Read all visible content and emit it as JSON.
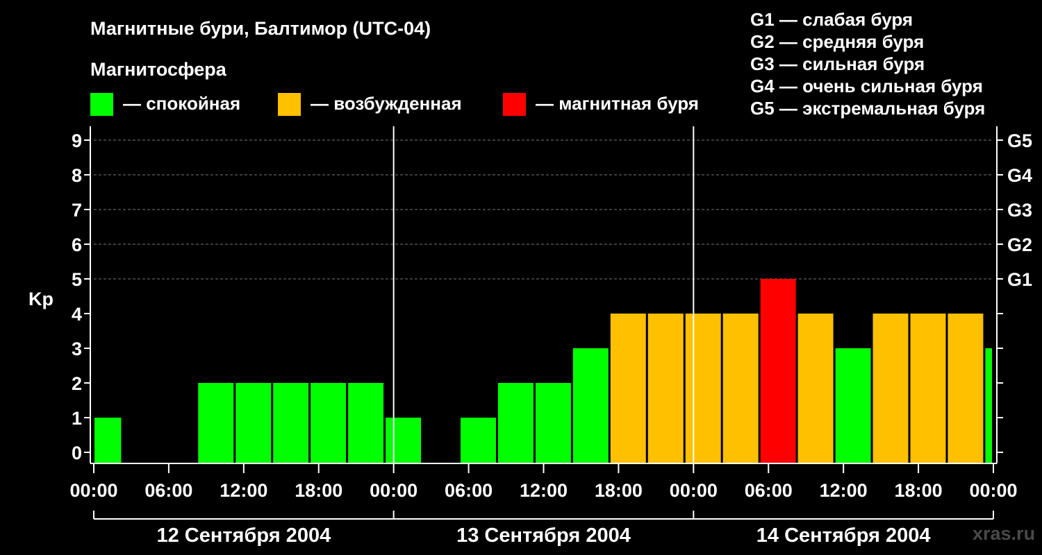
{
  "header": {
    "title": "Магнитные бури, Балтимор (UTC-04)",
    "subtitle": "Магнитосфера"
  },
  "legend_states": [
    {
      "label": "— спокойная",
      "color": "#00ff00"
    },
    {
      "label": "— возбужденная",
      "color": "#ffc000"
    },
    {
      "label": "— магнитная буря",
      "color": "#ff0000"
    }
  ],
  "legend_storms": [
    "G1 — слабая буря",
    "G2 — средняя буря",
    "G3 — сильная буря",
    "G4 — очень сильная буря",
    "G5 — экстремальная буря"
  ],
  "watermark": "xras.ru",
  "chart_data": {
    "type": "bar",
    "title": "Магнитные бури, Балтимор (UTC-04)",
    "ylabel": "Kp",
    "ylim": [
      0,
      9
    ],
    "yticks": [
      "0",
      "1",
      "2",
      "3",
      "4",
      "5",
      "6",
      "7",
      "8",
      "9"
    ],
    "right_axis": [
      {
        "kp": 5,
        "label": "G1"
      },
      {
        "kp": 6,
        "label": "G2"
      },
      {
        "kp": 7,
        "label": "G3"
      },
      {
        "kp": 8,
        "label": "G4"
      },
      {
        "kp": 9,
        "label": "G5"
      }
    ],
    "x_ticks": [
      "00:00",
      "06:00",
      "12:00",
      "18:00",
      "00:00",
      "06:00",
      "12:00",
      "18:00",
      "00:00",
      "06:00",
      "12:00",
      "18:00",
      "00:00"
    ],
    "days": [
      "12 Сентября 2004",
      "13 Сентября 2004",
      "14 Сентября 2004"
    ],
    "hours_span": 72,
    "bars": [
      {
        "start": 0,
        "end": 2.3,
        "kp": 1,
        "state": "quiet"
      },
      {
        "start": 2.3,
        "end": 5.3,
        "kp": 0,
        "state": "quiet"
      },
      {
        "start": 5.3,
        "end": 8.3,
        "kp": 0,
        "state": "quiet"
      },
      {
        "start": 8.3,
        "end": 11.3,
        "kp": 2,
        "state": "quiet"
      },
      {
        "start": 11.3,
        "end": 14.3,
        "kp": 2,
        "state": "quiet"
      },
      {
        "start": 14.3,
        "end": 17.3,
        "kp": 2,
        "state": "quiet"
      },
      {
        "start": 17.3,
        "end": 20.3,
        "kp": 2,
        "state": "quiet"
      },
      {
        "start": 20.3,
        "end": 23.3,
        "kp": 2,
        "state": "quiet"
      },
      {
        "start": 23.3,
        "end": 26.3,
        "kp": 1,
        "state": "quiet"
      },
      {
        "start": 26.3,
        "end": 29.3,
        "kp": 0,
        "state": "quiet"
      },
      {
        "start": 29.3,
        "end": 32.3,
        "kp": 1,
        "state": "quiet"
      },
      {
        "start": 32.3,
        "end": 35.3,
        "kp": 2,
        "state": "quiet"
      },
      {
        "start": 35.3,
        "end": 38.3,
        "kp": 2,
        "state": "quiet"
      },
      {
        "start": 38.3,
        "end": 41.3,
        "kp": 3,
        "state": "quiet"
      },
      {
        "start": 41.3,
        "end": 44.3,
        "kp": 4,
        "state": "active"
      },
      {
        "start": 44.3,
        "end": 47.3,
        "kp": 4,
        "state": "active"
      },
      {
        "start": 47.3,
        "end": 50.3,
        "kp": 4,
        "state": "active"
      },
      {
        "start": 50.3,
        "end": 53.3,
        "kp": 4,
        "state": "active"
      },
      {
        "start": 53.3,
        "end": 56.3,
        "kp": 5,
        "state": "storm"
      },
      {
        "start": 56.3,
        "end": 59.3,
        "kp": 4,
        "state": "active"
      },
      {
        "start": 59.3,
        "end": 62.3,
        "kp": 3,
        "state": "quiet"
      },
      {
        "start": 62.3,
        "end": 65.3,
        "kp": 4,
        "state": "active"
      },
      {
        "start": 65.3,
        "end": 68.3,
        "kp": 4,
        "state": "active"
      },
      {
        "start": 68.3,
        "end": 71.3,
        "kp": 4,
        "state": "active"
      },
      {
        "start": 71.3,
        "end": 72,
        "kp": 3,
        "state": "quiet"
      }
    ],
    "colors": {
      "quiet": "#00ff00",
      "active": "#ffc000",
      "storm": "#ff0000"
    },
    "grid": "dashed horizontal at Kp 5–9"
  }
}
